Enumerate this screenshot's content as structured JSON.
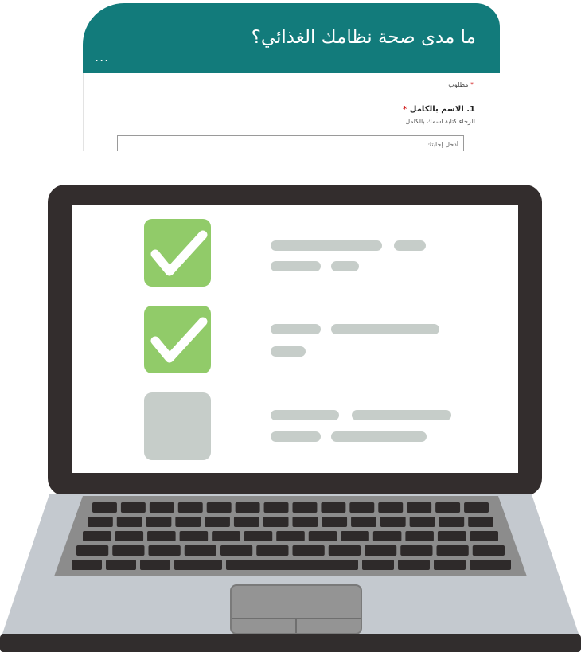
{
  "form": {
    "title": "ما مدى صحة نظامك الغذائي؟",
    "menu_label": "...",
    "required_note": "مطلوب",
    "required_marker": "*",
    "question": {
      "label": "1. الاسم بالكامل",
      "hint": "الرجاء كتابة اسمك بالكامل",
      "placeholder": "أدخل إجابتك"
    }
  },
  "checklist": {
    "items": [
      {
        "checked": true,
        "icon": "check-icon"
      },
      {
        "checked": true,
        "icon": "check-icon"
      },
      {
        "checked": false,
        "icon": ""
      }
    ]
  },
  "colors": {
    "header": "#127b7b",
    "checked": "#91cb69",
    "unchecked": "#c6cdc9",
    "laptop_frame": "#332d2d"
  }
}
